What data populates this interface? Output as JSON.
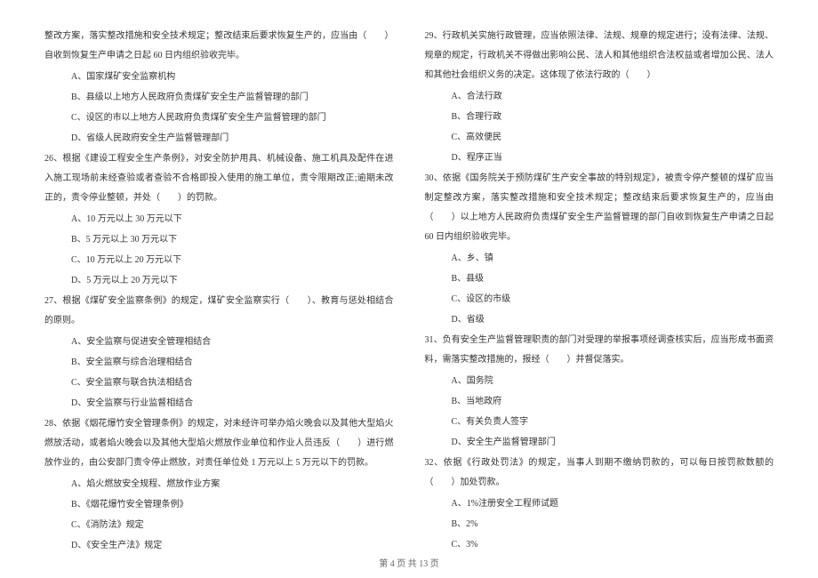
{
  "left_column": {
    "q25_continuation": "整改方案，落实整改措施和安全技术规定；整改结束后要求恢复生产的，应当由（　　）自收到恢复生产申请之日起 60 日内组织验收完毕。",
    "q25_options": {
      "a": "A、国家煤矿安全监察机构",
      "b": "B、县级以上地方人民政府负责煤矿安全生产监督管理的部门",
      "c": "C、设区的市以上地方人民政府负责煤矿安全生产监督管理的部门",
      "d": "D、省级人民政府安全生产监督管理部门"
    },
    "q26_text": "26、根据《建设工程安全生产条例》，对安全防护用具、机械设备、施工机具及配件在进入施工现场前未经查验或者查验不合格即投入使用的施工单位，责令限期改正;逾期未改正的，责令停业整顿，并处（　　）的罚款。",
    "q26_options": {
      "a": "A、10 万元以上 30 万元以下",
      "b": "B、5 万元以上 30 万元以下",
      "c": "C、10 万元以上 20 万元以下",
      "d": "D、5 万元以上 20 万元以下"
    },
    "q27_text": "27、根据《煤矿安全监察条例》的规定，煤矿安全监察实行（　　）、教育与惩处相结合的原则。",
    "q27_options": {
      "a": "A、安全监察与促进安全管理相结合",
      "b": "B、安全监察与综合治理相结合",
      "c": "C、安全监察与联合执法相结合",
      "d": "D、安全监察与行业监督相结合"
    },
    "q28_text": "28、依据《烟花爆竹安全管理条例》的规定，对未经许可举办焰火晚会以及其他大型焰火燃放活动，或者焰火晚会以及其他大型焰火燃放作业单位和作业人员违反（　　）进行燃放作业的，由公安部门责令停止燃放，对责任单位处 1 万元以上 5 万元以下的罚款。",
    "q28_options": {
      "a": "A、焰火燃放安全规程、燃放作业方案",
      "b": "B、《烟花爆竹安全管理条例》",
      "c": "C、《消防法》规定",
      "d": "D、《安全生产法》规定"
    }
  },
  "right_column": {
    "q29_text": "29、行政机关实施行政管理，应当依照法律、法规、规章的规定进行；没有法律、法规、规章的规定，行政机关不得做出影响公民、法人和其他组织合法权益或者增加公民、法人和其他社会组织义务的决定。这体现了依法行政的（　　）",
    "q29_options": {
      "a": "A、合法行政",
      "b": "B、合理行政",
      "c": "C、高效便民",
      "d": "D、程序正当"
    },
    "q30_text": "30、依据《国务院关于预防煤矿生产安全事故的特别规定》，被责令停产整顿的煤矿应当制定整改方案，落实整改措施和安全技术规定；整改结束后要求恢复生产的，应当由（　　）以上地方人民政府负责煤矿安全生产监督管理的部门自收到恢复生产申请之日起 60 日内组织验收完毕。",
    "q30_options": {
      "a": "A、乡、镇",
      "b": "B、县级",
      "c": "C、设区的市级",
      "d": "D、省级"
    },
    "q31_text": "31、负有安全生产监督管理职责的部门对受理的举报事项经调查核实后，应当形成书面资料，需落实整改措施的，报经（　　）并督促落实。",
    "q31_options": {
      "a": "A、国务院",
      "b": "B、当地政府",
      "c": "C、有关负责人签字",
      "d": "D、安全生产监督管理部门"
    },
    "q32_text": "32、依据《行政处罚法》的规定，当事人到期不缴纳罚款的，可以每日按罚款数额的（　　）加处罚款。",
    "q32_options": {
      "a": "A、1%注册安全工程师试题",
      "b": "B、2%",
      "c": "C、3%"
    }
  },
  "footer": "第 4 页 共 13 页"
}
